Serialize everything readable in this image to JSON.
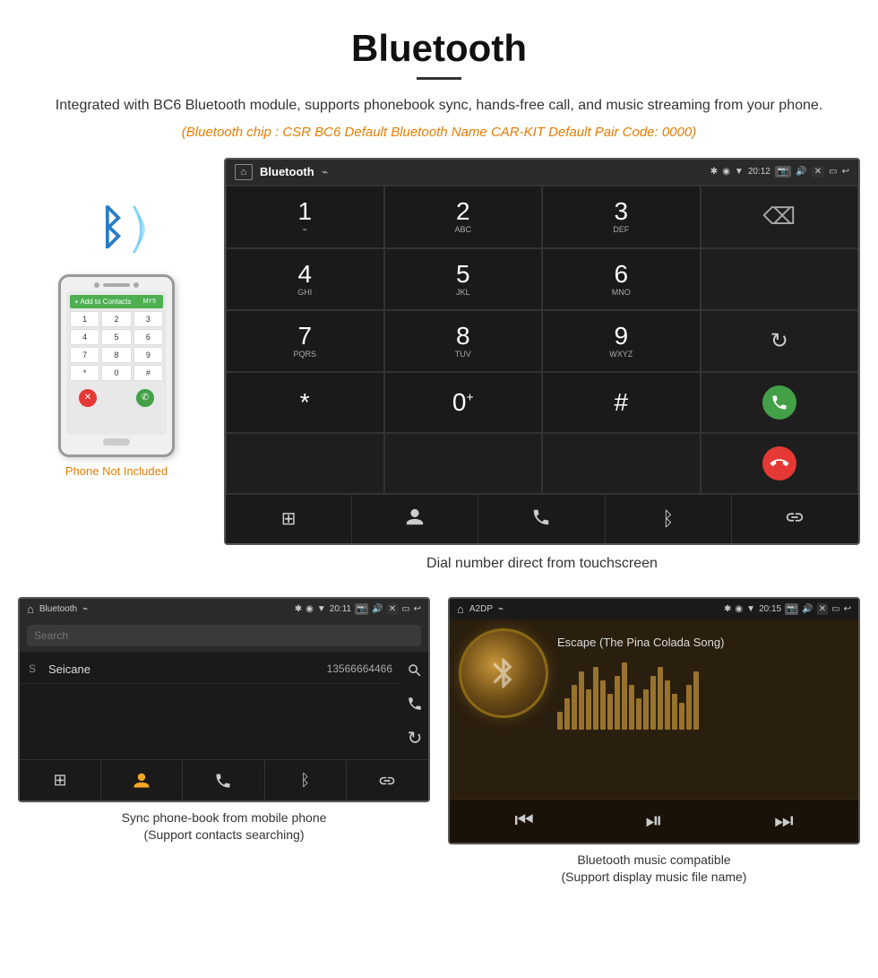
{
  "page": {
    "title": "Bluetooth",
    "title_underline": true,
    "description": "Integrated with BC6 Bluetooth module, supports phonebook sync, hands-free call, and music streaming from your phone.",
    "orange_info": "(Bluetooth chip : CSR BC6    Default Bluetooth Name CAR-KIT    Default Pair Code: 0000)"
  },
  "phone_area": {
    "not_included_label": "Phone Not Included"
  },
  "car_screen_dialpad": {
    "status_bar": {
      "title": "Bluetooth",
      "time": "20:12",
      "usb_icon": "⌁",
      "bt_icon": "✱",
      "location_icon": "◉",
      "signal_icon": "▼",
      "camera_icon": "📷",
      "volume_icon": "🔊",
      "close_icon": "✕",
      "window_icon": "▭",
      "back_icon": "↩"
    },
    "keys": [
      {
        "num": "1",
        "sub": "⌁",
        "type": "normal"
      },
      {
        "num": "2",
        "sub": "ABC",
        "type": "normal"
      },
      {
        "num": "3",
        "sub": "DEF",
        "type": "normal"
      },
      {
        "num": "",
        "sub": "",
        "type": "backspace"
      },
      {
        "num": "4",
        "sub": "GHI",
        "type": "normal"
      },
      {
        "num": "5",
        "sub": "JKL",
        "type": "normal"
      },
      {
        "num": "6",
        "sub": "MNO",
        "type": "normal"
      },
      {
        "num": "",
        "sub": "",
        "type": "empty"
      },
      {
        "num": "7",
        "sub": "PQRS",
        "type": "normal"
      },
      {
        "num": "8",
        "sub": "TUV",
        "type": "normal"
      },
      {
        "num": "9",
        "sub": "WXYZ",
        "type": "normal"
      },
      {
        "num": "",
        "sub": "",
        "type": "refresh"
      },
      {
        "num": "*",
        "sub": "",
        "type": "symbol"
      },
      {
        "num": "0",
        "sub": "+",
        "type": "zero"
      },
      {
        "num": "#",
        "sub": "",
        "type": "symbol"
      },
      {
        "num": "",
        "sub": "",
        "type": "green-call"
      },
      {
        "num": "",
        "sub": "",
        "type": "red-call"
      }
    ],
    "bottom_icons": [
      "⊞",
      "⚇",
      "☎",
      "✱",
      "⛓"
    ],
    "caption": "Dial number direct from touchscreen"
  },
  "phonebook_screen": {
    "status_bar": {
      "title": "Bluetooth",
      "time": "20:11"
    },
    "search_placeholder": "Search",
    "contacts": [
      {
        "letter": "S",
        "name": "Seicane",
        "number": "13566664466"
      }
    ],
    "bottom_icons": [
      "⊞",
      "👤",
      "☎",
      "✱",
      "⛓"
    ],
    "caption_line1": "Sync phone-book from mobile phone",
    "caption_line2": "(Support contacts searching)"
  },
  "music_screen": {
    "status_bar": {
      "title": "A2DP",
      "time": "20:15"
    },
    "song_title": "Escape (The Pina Colada Song)",
    "eq_bars": [
      20,
      35,
      50,
      65,
      45,
      70,
      55,
      40,
      60,
      75,
      50,
      35,
      45,
      60,
      70,
      55,
      40,
      30,
      50,
      65
    ],
    "controls": [
      "⏮",
      "⏯",
      "⏭"
    ],
    "caption_line1": "Bluetooth music compatible",
    "caption_line2": "(Support display music file name)"
  },
  "icons": {
    "home": "⌂",
    "bluetooth": "ᛒ",
    "search": "🔍",
    "phone": "📞",
    "refresh": "↻",
    "backspace": "⌫",
    "grid": "⊞",
    "person": "⚇",
    "link": "⛓",
    "prev": "⏮",
    "playpause": "⏯",
    "next": "⏭"
  }
}
